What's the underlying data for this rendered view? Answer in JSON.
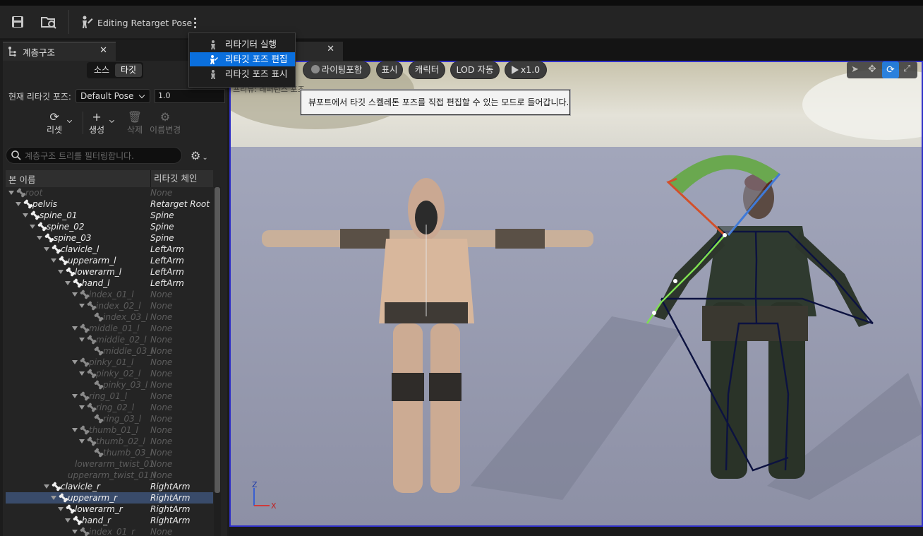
{
  "toolbar": {
    "save_icon": "save-icon",
    "browse_icon": "browse-asset-icon",
    "mode_label": "Editing Retarget Pose",
    "mode_icon": "edit-pose-icon",
    "more_icon": "kebab-menu-icon"
  },
  "dropdown_menu": {
    "items": [
      {
        "label": "리타기터 실행",
        "icon": "run-retargeter-icon"
      },
      {
        "label": "리타깃 포즈 편집",
        "icon": "edit-pose-icon",
        "highlighted": true
      },
      {
        "label": "리타깃 포즈 표시",
        "icon": "show-pose-icon"
      }
    ]
  },
  "tooltip": {
    "text": "뷰포트에서 타깃 스켈레톤 포즈를 직접 편집할 수 있는 모드로 들어갑니다."
  },
  "hierarchy_panel": {
    "tab_title": "계층구조",
    "source_label": "소스",
    "target_label": "타깃",
    "current_pose_label": "현재 리타깃 포즈:",
    "current_pose_value": "Default Pose",
    "blend_value": "1.0",
    "actions": [
      {
        "label": "리셋",
        "icon": "reset-icon",
        "enabled": true
      },
      {
        "label": "생성",
        "icon": "add-icon",
        "enabled": true
      },
      {
        "label": "삭제",
        "icon": "delete-icon",
        "enabled": false
      },
      {
        "label": "이름변경",
        "icon": "rename-icon",
        "enabled": false
      }
    ],
    "filter_placeholder": "계층구조 트리를 필터링합니다.",
    "columns": {
      "bone_name": "본 이름",
      "retarget_chain": "리타깃 체인"
    },
    "rows": [
      {
        "name": "root",
        "chain": "None",
        "depth": 0,
        "style": "g",
        "arrow": true
      },
      {
        "name": "pelvis",
        "chain": "Retarget Root",
        "depth": 1,
        "style": "w",
        "arrow": true
      },
      {
        "name": "spine_01",
        "chain": "Spine",
        "depth": 2,
        "style": "w",
        "arrow": true
      },
      {
        "name": "spine_02",
        "chain": "Spine",
        "depth": 3,
        "style": "w",
        "arrow": true
      },
      {
        "name": "spine_03",
        "chain": "Spine",
        "depth": 4,
        "style": "w",
        "arrow": true
      },
      {
        "name": "clavicle_l",
        "chain": "LeftArm",
        "depth": 5,
        "style": "w",
        "arrow": true
      },
      {
        "name": "upperarm_l",
        "chain": "LeftArm",
        "depth": 6,
        "style": "w",
        "arrow": true
      },
      {
        "name": "lowerarm_l",
        "chain": "LeftArm",
        "depth": 7,
        "style": "w",
        "arrow": true
      },
      {
        "name": "hand_l",
        "chain": "LeftArm",
        "depth": 8,
        "style": "w",
        "arrow": true
      },
      {
        "name": "index_01_l",
        "chain": "None",
        "depth": 9,
        "style": "g",
        "arrow": true
      },
      {
        "name": "index_02_l",
        "chain": "None",
        "depth": 10,
        "style": "g",
        "arrow": true
      },
      {
        "name": "index_03_l",
        "chain": "None",
        "depth": 11,
        "style": "g",
        "arrow": false
      },
      {
        "name": "middle_01_l",
        "chain": "None",
        "depth": 9,
        "style": "g",
        "arrow": true
      },
      {
        "name": "middle_02_l",
        "chain": "None",
        "depth": 10,
        "style": "g",
        "arrow": true
      },
      {
        "name": "middle_03_l",
        "chain": "None",
        "depth": 11,
        "style": "g",
        "arrow": false
      },
      {
        "name": "pinky_01_l",
        "chain": "None",
        "depth": 9,
        "style": "g",
        "arrow": true
      },
      {
        "name": "pinky_02_l",
        "chain": "None",
        "depth": 10,
        "style": "g",
        "arrow": true
      },
      {
        "name": "pinky_03_l",
        "chain": "None",
        "depth": 11,
        "style": "g",
        "arrow": false
      },
      {
        "name": "ring_01_l",
        "chain": "None",
        "depth": 9,
        "style": "g",
        "arrow": true
      },
      {
        "name": "ring_02_l",
        "chain": "None",
        "depth": 10,
        "style": "g",
        "arrow": true
      },
      {
        "name": "ring_03_l",
        "chain": "None",
        "depth": 11,
        "style": "g",
        "arrow": false
      },
      {
        "name": "thumb_01_l",
        "chain": "None",
        "depth": 9,
        "style": "g",
        "arrow": true
      },
      {
        "name": "thumb_02_l",
        "chain": "None",
        "depth": 10,
        "style": "g",
        "arrow": true
      },
      {
        "name": "thumb_03_l",
        "chain": "None",
        "depth": 11,
        "style": "g",
        "arrow": false
      },
      {
        "name": "lowerarm_twist_01",
        "chain": "None",
        "depth": 8,
        "style": "g",
        "arrow": false,
        "nobone": true
      },
      {
        "name": "upperarm_twist_01_l",
        "chain": "None",
        "depth": 7,
        "style": "g",
        "arrow": false,
        "nobone": true
      },
      {
        "name": "clavicle_r",
        "chain": "RightArm",
        "depth": 5,
        "style": "w",
        "arrow": true
      },
      {
        "name": "upperarm_r",
        "chain": "RightArm",
        "depth": 6,
        "style": "w",
        "arrow": true,
        "selected": true
      },
      {
        "name": "lowerarm_r",
        "chain": "RightArm",
        "depth": 7,
        "style": "w",
        "arrow": true
      },
      {
        "name": "hand_r",
        "chain": "RightArm",
        "depth": 8,
        "style": "w",
        "arrow": true
      },
      {
        "name": "index_01_r",
        "chain": "None",
        "depth": 9,
        "style": "g",
        "arrow": true
      }
    ]
  },
  "viewport": {
    "options": [
      {
        "label": "라이팅포함",
        "icon": "lighting-icon"
      },
      {
        "label": "표시"
      },
      {
        "label": "캐릭터"
      },
      {
        "label": "LOD 자동"
      },
      {
        "label": "x1.0",
        "icon": "play-icon"
      }
    ],
    "overlay_label": "프리뷰: 레퍼런스 포즈",
    "axis": {
      "z": "Z",
      "x": "X"
    },
    "selection_color": "#3030c8",
    "highlight_color": "#0a6fdd"
  }
}
